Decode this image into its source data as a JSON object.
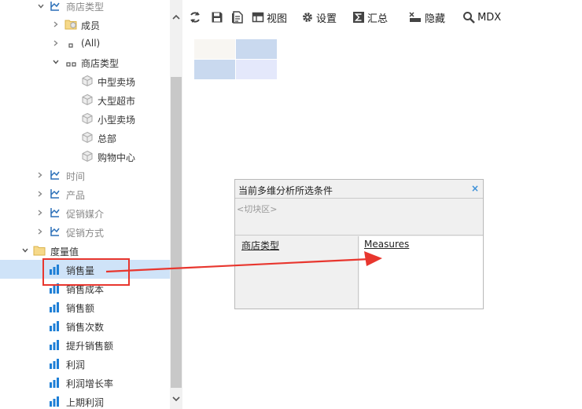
{
  "tree": {
    "dim_store_type": "商店类型",
    "member_group": "成员",
    "all_item": "(All)",
    "level_store_type": "商店类型",
    "members": [
      "中型卖场",
      "大型超市",
      "小型卖场",
      "总部",
      "购物中心"
    ],
    "dim_time": "时间",
    "dim_product": "产品",
    "dim_promo_media": "促销媒介",
    "dim_promo_method": "促销方式",
    "measures_folder": "度量值",
    "measures": [
      "销售量",
      "销售成本",
      "销售额",
      "销售次数",
      "提升销售额",
      "利润",
      "利润增长率",
      "上期利润"
    ]
  },
  "toolbar": {
    "view": "视图",
    "settings": "设置",
    "summary": "汇总",
    "hide": "隐藏",
    "mdx": "MDX"
  },
  "panel": {
    "title": "当前多维分析所选条件",
    "close": "×",
    "slice_placeholder": "<切块区>",
    "rows_item": "商店类型",
    "cols_item": "Measures"
  },
  "colors": {
    "highlight": "#e8362e",
    "selection": "#cfe3f8",
    "measure_icon": "#1e7fd6"
  }
}
